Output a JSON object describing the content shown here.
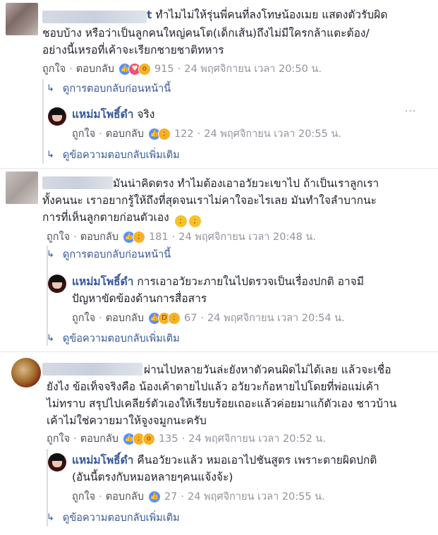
{
  "comments": [
    {
      "name_suffix": "t",
      "text": "ทำไมไม่ให้รุ่นพี่คนที่ลงโทษน้องเมย แสดงตัวรับผิดชอบบ้าง หรือว่าเป็นลูกคนใหญ่คนโต(เด็กเส้น)ถึงไม่มีใครกล้าแตะต้อง/อย่างนี้เหรอที่เค้าจะเรียกชายชาติทหาร",
      "lines": [
        "ทำไมไม่ให้รุ่นพี่คนที่ลงโทษน้องเมย แสดงตัวรับผิด",
        "ชอบบ้าง หรือว่าเป็นลูกคนใหญ่คนโต(เด็กเส้น)ถึงไม่มีใครกล้าแตะต้อง/",
        "อย่างนี้เหรอที่เค้าจะเรียกชายชาติทหาร"
      ],
      "like": "ถูกใจ",
      "reply": "ตอบกลับ",
      "count": "915",
      "time": "24 พฤศจิกายน เวลา 20:50 น.",
      "prev_link": "ดูการตอบกลับก่อนหน้านี้",
      "page_reply": {
        "name": "แหม่มโพธิ์ดำ",
        "text": "จริง",
        "lines": [
          "จริง"
        ],
        "like": "ถูกใจ",
        "reply": "ตอบกลับ",
        "count": "122",
        "time": "24 พฤศจิกายน เวลา 20:55 น."
      },
      "more_link": "ดูข้อความตอบกลับเพิ่มเติม"
    },
    {
      "text": "มันน่าคิดตรง ทำไมต้องเอาอวัยวะเขาไป ถ้าเป็นเราลูกเราทั้งคนนะ เราอยากรู้ให้ถึงที่สุดจนเราไม่คาใจอะไรเลย มันทำใจลำบากนะการที่เห็นลูกตายก่อนตัวเอง",
      "lines": [
        "มันน่าคิดตรง ทำไมต้องเอาอวัยวะเขาไป ถ้าเป็นเราลูกเรา",
        "ทั้งคนนะ เราอยากรู้ให้ถึงที่สุดจนเราไม่คาใจอะไรเลย มันทำใจลำบากนะ",
        "การที่เห็นลูกตายก่อนตัวเอง"
      ],
      "like": "ถูกใจ",
      "reply": "ตอบกลับ",
      "count": "181",
      "time": "24 พฤศจิกายน เวลา 20:48 น.",
      "prev_link": "ดูการตอบกลับก่อนหน้านี้",
      "page_reply": {
        "name": "แหม่มโพธิ์ดำ",
        "text": "การเอาอวัยวะภายในไปตรวจเป็นเรื่องปกติ อาจมีปัญหาขัดข้องด้านการสื่อสาร",
        "lines": [
          "การเอาอวัยวะภายในไปตรวจเป็นเรื่องปกติ อาจมี",
          "ปัญหาขัดข้องด้านการสื่อสาร"
        ],
        "like": "ถูกใจ",
        "reply": "ตอบกลับ",
        "count": "67",
        "time": "24 พฤศจิกายน เวลา 20:54 น."
      },
      "more_link": "ดูข้อความตอบกลับเพิ่มเติม"
    },
    {
      "text": "ผ่านไปหลายวันล่ะยังหาตัวคนผิดไม่ได้เลย แล้วจะเชื่อยังไง ข้อเท็จจริงคือ น้องเค้าตายไปแล้ว อวัยวะก้อหายไปโดยที่พ่อแม่เค้าไม่ทราบ สรุปไปเคลียร์ตัวเองให้เรียบร้อยเถอะแล้วค่อยมาแก้ตัวเอง ชาวบ้านเค้าไม่ใช่ควายมาให้จูงจมูกนะครับ",
      "lines": [
        "ผ่านไปหลายวันล่ะยังหาตัวคนผิดไม่ได้เลย แล้วจะเชื่อ",
        "ยังไง ข้อเท็จจริงคือ น้องเค้าตายไปแล้ว อวัยวะก้อหายไปโดยที่พ่อแม่เค้า",
        "ไม่ทราบ สรุปไปเคลียร์ตัวเองให้เรียบร้อยเถอะแล้วค่อยมาแก้ตัวเอง ชาวบ้าน",
        "เค้าไม่ใช่ควายมาให้จูงจมูกนะครับ"
      ],
      "like": "ถูกใจ",
      "reply": "ตอบกลับ",
      "count": "135",
      "time": "24 พฤศจิกายน เวลา 20:52 น.",
      "page_reply": {
        "name": "แหม่มโพธิ์ดำ",
        "text": "คืนอวัยวะแล้ว หมอเอาไปชันสูตร เพราะตายผิดปกติ(อันนี้ตรงกับหมอหลายๆคนแจ้งจ้ะ)",
        "lines": [
          "คืนอวัยวะแล้ว หมอเอาไปชันสูตร เพราะตายผิดปกติ",
          "(อันนี้ตรงกับหมอหลายๆคนแจ้งจ้ะ)"
        ],
        "like": "ถูกใจ",
        "reply": "ตอบกลับ",
        "count": "27",
        "time": "24 พฤศจิกายน เวลา 20:55 น."
      },
      "more_link": "ดูข้อความตอบกลับเพิ่มเติม"
    }
  ],
  "ui": {
    "dot": "·",
    "more_options": "···",
    "reply_arrow": "↳"
  },
  "colors": {
    "link": "#365899",
    "meta": "#90949c",
    "like": "#5890ff",
    "love": "#f25268",
    "emoji": "#f7b125"
  }
}
